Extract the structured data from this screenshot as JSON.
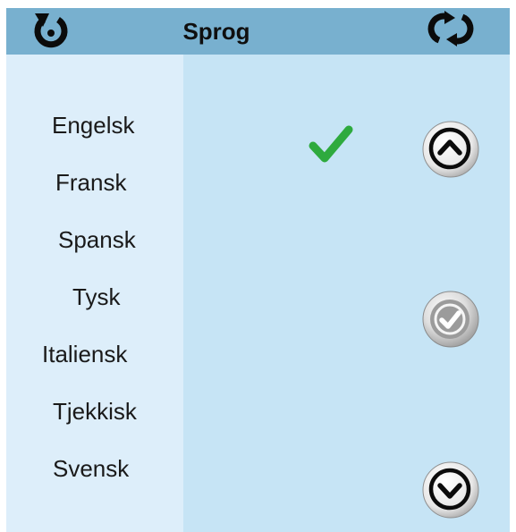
{
  "header": {
    "title": "Sprog",
    "back_icon": "back-circular-arrow-icon",
    "refresh_icon": "refresh-icon"
  },
  "languages": [
    {
      "label": "Engelsk",
      "selected": true
    },
    {
      "label": "Fransk",
      "selected": false
    },
    {
      "label": "Spansk",
      "selected": false
    },
    {
      "label": "Tysk",
      "selected": false
    },
    {
      "label": "Italiensk",
      "selected": false
    },
    {
      "label": "Tjekkisk",
      "selected": false
    },
    {
      "label": "Svensk",
      "selected": false
    }
  ],
  "controls": {
    "up_icon": "chevron-up-icon",
    "confirm_icon": "confirm-check-icon",
    "down_icon": "chevron-down-icon",
    "selected_icon": "green-check-icon"
  },
  "colors": {
    "header_bg": "#78b0cf",
    "content_bg": "#c6e4f5",
    "list_bg": "#ddeefa",
    "check_green": "#2eaa3e"
  }
}
